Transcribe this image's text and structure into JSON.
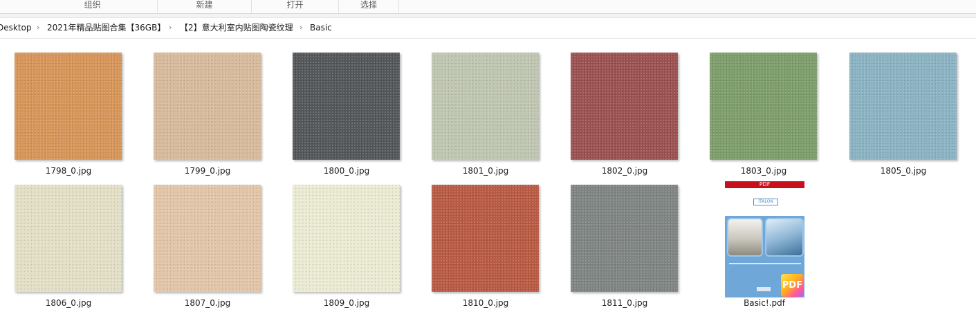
{
  "ribbon": {
    "groups": [
      "组织",
      "新建",
      "打开",
      "选择"
    ]
  },
  "address": {
    "crumbs": [
      "Desktop",
      "2021年精品贴图合集【36GB】",
      "【2】意大利室内贴图陶瓷纹理",
      "Basic"
    ],
    "separator": "›"
  },
  "files": [
    {
      "name": "1798_0.jpg",
      "color": "#d89558"
    },
    {
      "name": "1799_0.jpg",
      "color": "#d8bb9c"
    },
    {
      "name": "1800_0.jpg",
      "color": "#545759"
    },
    {
      "name": "1801_0.jpg",
      "color": "#bfc6b1"
    },
    {
      "name": "1802_0.jpg",
      "color": "#9b5150"
    },
    {
      "name": "1803_0.jpg",
      "color": "#7d9e6a"
    },
    {
      "name": "1805_0.jpg",
      "color": "#8bb3c3"
    },
    {
      "name": "1806_0.jpg",
      "color": "#e4e0c6"
    },
    {
      "name": "1807_0.jpg",
      "color": "#e3c6a9"
    },
    {
      "name": "1809_0.jpg",
      "color": "#ecebd3"
    },
    {
      "name": "1810_0.jpg",
      "color": "#b95a43"
    },
    {
      "name": "1811_0.jpg",
      "color": "#7f8582"
    },
    {
      "name": "Basic!.pdf",
      "color": "#6fa8d8"
    }
  ],
  "pdf": {
    "banner": "PDF",
    "logo": "ITALON",
    "badge": "PDF"
  }
}
